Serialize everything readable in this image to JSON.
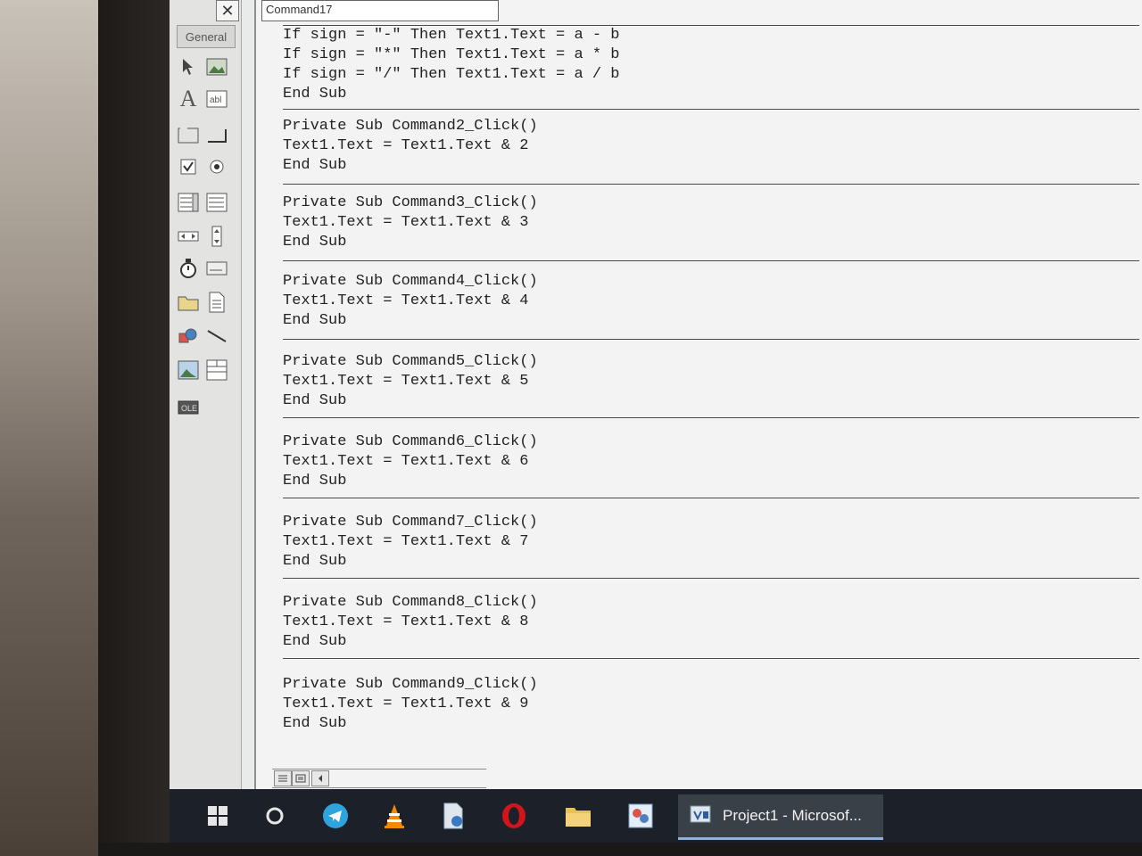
{
  "toolbox": {
    "header": "General",
    "close_glyph": "✕",
    "tools": [
      {
        "icon": "pointer-icon"
      },
      {
        "icon": "picturebox-icon"
      },
      {
        "icon": "label-icon"
      },
      {
        "icon": "textbox-icon"
      },
      {
        "icon": "frame-icon"
      },
      {
        "icon": "commandbutton-icon"
      },
      {
        "icon": "checkbox-icon"
      },
      {
        "icon": "optionbutton-icon"
      },
      {
        "icon": "combobox-icon"
      },
      {
        "icon": "listbox-icon"
      },
      {
        "icon": "hscrollbar-icon"
      },
      {
        "icon": "vscrollbar-icon"
      },
      {
        "icon": "timer-icon"
      },
      {
        "icon": "drivelistbox-icon"
      },
      {
        "icon": "dirlistbox-icon"
      },
      {
        "icon": "filelistbox-icon"
      },
      {
        "icon": "shape-icon"
      },
      {
        "icon": "line-icon"
      },
      {
        "icon": "image-icon"
      },
      {
        "icon": "data-icon"
      },
      {
        "icon": "ole-icon"
      }
    ]
  },
  "editor": {
    "object_combo": "Command17",
    "procedures": [
      {
        "lines": [
          "If sign = \"-\" Then Text1.Text = a - b",
          "If sign = \"*\" Then Text1.Text = a * b",
          "If sign = \"/\" Then Text1.Text = a / b",
          "End Sub"
        ]
      },
      {
        "lines": [
          "Private Sub Command2_Click()",
          "Text1.Text = Text1.Text & 2",
          "End Sub"
        ]
      },
      {
        "lines": [
          "Private Sub Command3_Click()",
          "Text1.Text = Text1.Text & 3",
          "End Sub"
        ]
      },
      {
        "lines": [
          "Private Sub Command4_Click()",
          "Text1.Text = Text1.Text & 4",
          "End Sub"
        ]
      },
      {
        "lines": [
          "Private Sub Command5_Click()",
          "Text1.Text = Text1.Text & 5",
          "End Sub"
        ]
      },
      {
        "lines": [
          "Private Sub Command6_Click()",
          "Text1.Text = Text1.Text & 6",
          "End Sub"
        ]
      },
      {
        "lines": [
          "Private Sub Command7_Click()",
          "Text1.Text = Text1.Text & 7",
          "End Sub"
        ]
      },
      {
        "lines": [
          "Private Sub Command8_Click()",
          "Text1.Text = Text1.Text & 8",
          "End Sub"
        ]
      },
      {
        "lines": [
          "Private Sub Command9_Click()",
          "Text1.Text = Text1.Text & 9",
          "End Sub"
        ]
      }
    ]
  },
  "taskbar": {
    "items": [
      "windows-start-icon",
      "cortana-icon",
      "telegram-icon",
      "vlc-icon",
      "file-icon",
      "opera-icon",
      "file-explorer-icon",
      "paint-icon"
    ],
    "active_app": "Project1 - Microsof..."
  },
  "colors": {
    "taskbar": "#1c2129",
    "code_bg": "#f2f3f2",
    "opera_red": "#d4141b",
    "telegram_blue": "#2ea3dd",
    "vlc_orange": "#f08a00"
  }
}
